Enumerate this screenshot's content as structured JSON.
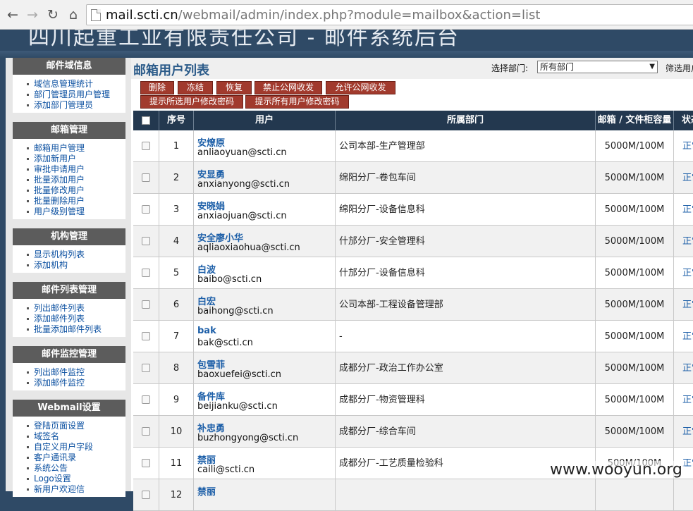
{
  "browser": {
    "url_host": "mail.scti.cn",
    "url_path": "/webmail/admin/index.php?module=mailbox&action=list"
  },
  "banner": {
    "title": "四川起重工业有限责任公司 - 邮件系统后台"
  },
  "sidebar": {
    "panels": [
      {
        "title": "邮件域信息",
        "items": [
          "域信息管理统计",
          "部门管理员用户管理",
          "添加部门管理员"
        ]
      },
      {
        "title": "邮箱管理",
        "items": [
          "邮箱用户管理",
          "添加新用户",
          "审批申请用户",
          "批量添加用户",
          "批量修改用户",
          "批量删除用户",
          "用户级别管理"
        ]
      },
      {
        "title": "机构管理",
        "items": [
          "显示机构列表",
          "添加机构"
        ]
      },
      {
        "title": "邮件列表管理",
        "items": [
          "列出邮件列表",
          "添加邮件列表",
          "批量添加邮件列表"
        ]
      },
      {
        "title": "邮件监控管理",
        "items": [
          "列出邮件监控",
          "添加邮件监控"
        ]
      },
      {
        "title": "Webmail设置",
        "items": [
          "登陆页面设置",
          "域签名",
          "自定义用户字段",
          "客户通讯录",
          "系统公告",
          "Logo设置",
          "新用户欢迎信"
        ]
      }
    ]
  },
  "main": {
    "title": "邮箱用户列表",
    "dept_label": "选择部门:",
    "dept_selected": "所有部门",
    "filter_label": "筛选用户",
    "buttons": {
      "delete": "删除",
      "freeze": "冻结",
      "restore": "恢复",
      "block_public": "禁止公网收发",
      "allow_public": "允许公网收发",
      "prompt_selected_pw": "提示所选用户修改密码",
      "prompt_all_pw": "提示所有用户修改密码"
    },
    "table": {
      "headers": {
        "seq": "序号",
        "user": "用户",
        "dept": "所属部门",
        "quota": "邮箱 / 文件柜容量",
        "status": "状态"
      },
      "rows": [
        {
          "seq": "1",
          "name": "安燎原",
          "email": "anliaoyuan@scti.cn",
          "dept": "公司本部-生产管理部",
          "quota": "5000M/100M",
          "status": "正常"
        },
        {
          "seq": "2",
          "name": "安显勇",
          "email": "anxianyong@scti.cn",
          "dept": "绵阳分厂-卷包车间",
          "quota": "5000M/100M",
          "status": "正常"
        },
        {
          "seq": "3",
          "name": "安晓娟",
          "email": "anxiaojuan@scti.cn",
          "dept": "绵阳分厂-设备信息科",
          "quota": "5000M/100M",
          "status": "正常"
        },
        {
          "seq": "4",
          "name": "安全廖小华",
          "email": "aqliaoxiaohua@scti.cn",
          "dept": "什邡分厂-安全管理科",
          "quota": "5000M/100M",
          "status": "正常"
        },
        {
          "seq": "5",
          "name": "白波",
          "email": "baibo@scti.cn",
          "dept": "什邡分厂-设备信息科",
          "quota": "5000M/100M",
          "status": "正常"
        },
        {
          "seq": "6",
          "name": "白宏",
          "email": "baihong@scti.cn",
          "dept": "公司本部-工程设备管理部",
          "quota": "5000M/100M",
          "status": "正常"
        },
        {
          "seq": "7",
          "name": "bak",
          "email": "bak@scti.cn",
          "dept": "-",
          "quota": "5000M/100M",
          "status": "正常"
        },
        {
          "seq": "8",
          "name": "包雪菲",
          "email": "baoxuefei@scti.cn",
          "dept": "成都分厂-政治工作办公室",
          "quota": "5000M/100M",
          "status": "正常"
        },
        {
          "seq": "9",
          "name": "备件库",
          "email": "beijianku@scti.cn",
          "dept": "成都分厂-物资管理科",
          "quota": "5000M/100M",
          "status": "正常"
        },
        {
          "seq": "10",
          "name": "补忠勇",
          "email": "buzhongyong@scti.cn",
          "dept": "成都分厂-综合车间",
          "quota": "5000M/100M",
          "status": "正常"
        },
        {
          "seq": "11",
          "name": "禁丽",
          "email": "caili@scti.cn",
          "dept": "成都分厂-工艺质量检验科",
          "quota": "500M/100M",
          "status": "正常"
        },
        {
          "seq": "12",
          "name": "禁丽",
          "email": "",
          "dept": "",
          "quota": "",
          "status": ""
        }
      ]
    }
  },
  "watermark": "www.wooyun.org"
}
